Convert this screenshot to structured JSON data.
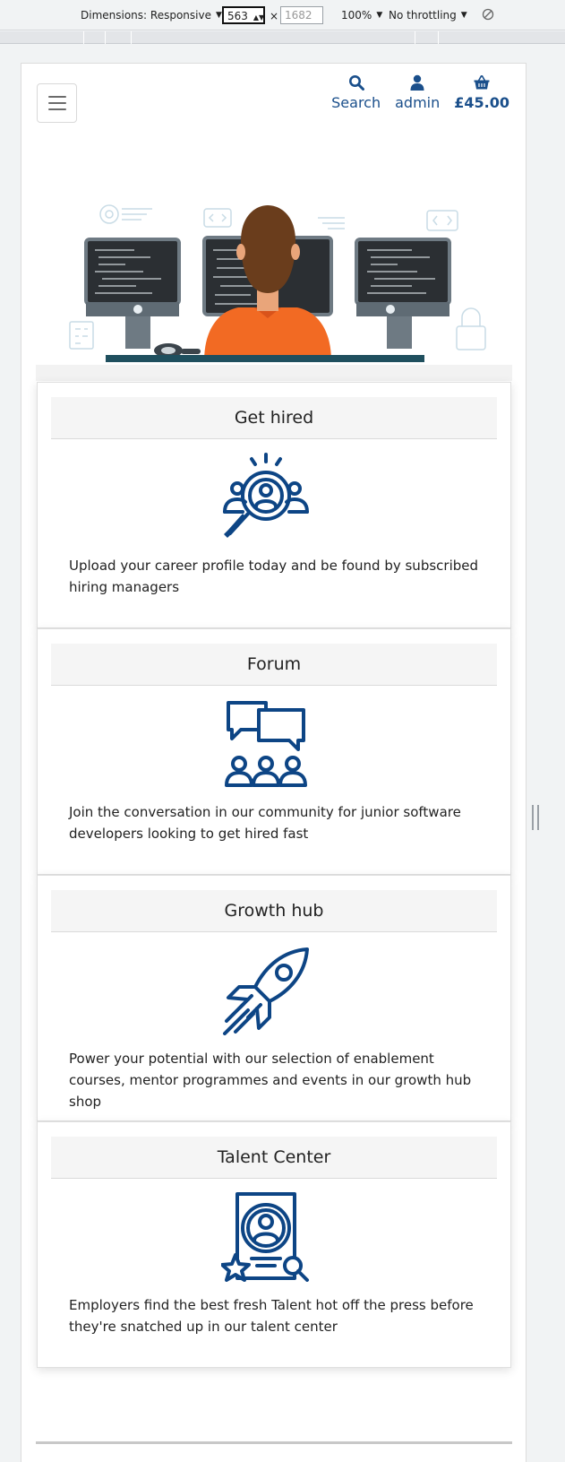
{
  "devtools": {
    "dimensions_label": "Dimensions: Responsive",
    "width_value": "563",
    "height_value": "1682",
    "times": "×",
    "zoom": "100%",
    "throttling": "No throttling"
  },
  "header": {
    "search_label": "Search",
    "account_label": "admin",
    "basket_total": "£45.00"
  },
  "cards": [
    {
      "title": "Get hired",
      "icon": "recruitment-search-icon",
      "text": "Upload your career profile today and be found by subscribed hiring managers"
    },
    {
      "title": "Forum",
      "icon": "community-chat-icon",
      "text": "Join the conversation in our community for junior software developers looking to get hired fast"
    },
    {
      "title": "Growth hub",
      "icon": "rocket-icon",
      "text": "Power your potential with our selection of enablement courses, mentor programmes and events in our growth hub shop"
    },
    {
      "title": "Talent Center",
      "icon": "talent-profile-icon",
      "text": "Employers find the best fresh Talent hot off the press before they're snatched up in our talent center"
    }
  ],
  "colors": {
    "brand": "#1a4f8b",
    "hero_shirt": "#f26a23",
    "card_header": "#f5f5f5"
  }
}
